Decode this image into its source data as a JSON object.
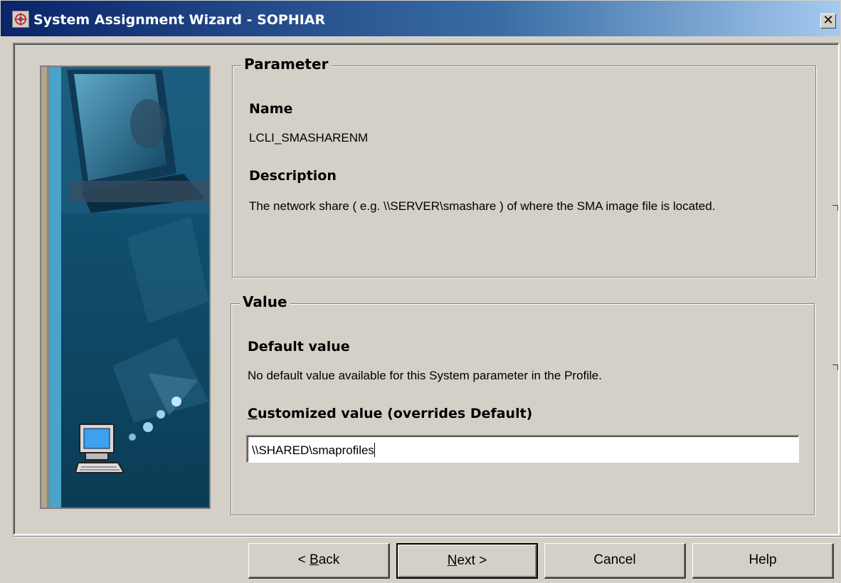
{
  "window": {
    "title": "System Assignment Wizard - SOPHIAR",
    "close_label": "✕"
  },
  "parameter": {
    "group_label": "Parameter",
    "name_heading": "Name",
    "name_value": "LCLI_SMASHARENM",
    "description_heading": "Description",
    "description_text": "The network share ( e.g. \\\\SERVER\\smashare ) of where the SMA image file is located."
  },
  "value": {
    "group_label": "Value",
    "default_heading": "Default value",
    "default_text": "No default value available for this System parameter in the Profile.",
    "customized_label_first": "C",
    "customized_label_rest": "ustomized value (overrides Default)",
    "customized_value": "\\\\SHARED\\smaprofiles"
  },
  "buttons": {
    "back_prefix": "< ",
    "back_accel": "B",
    "back_rest": "ack",
    "next_accel": "N",
    "next_rest": "ext >",
    "cancel": "Cancel",
    "help": "Help"
  },
  "icons": {
    "window": "wizard-app-icon",
    "close": "close-icon",
    "side": "computer-illustration",
    "small_pc": "desktop-computer-icon"
  },
  "colors": {
    "dialog_bg": "#d4d0c8",
    "titlebar_start": "#0a246a",
    "titlebar_end": "#a6caf0",
    "side_panel": "#0d4660"
  }
}
